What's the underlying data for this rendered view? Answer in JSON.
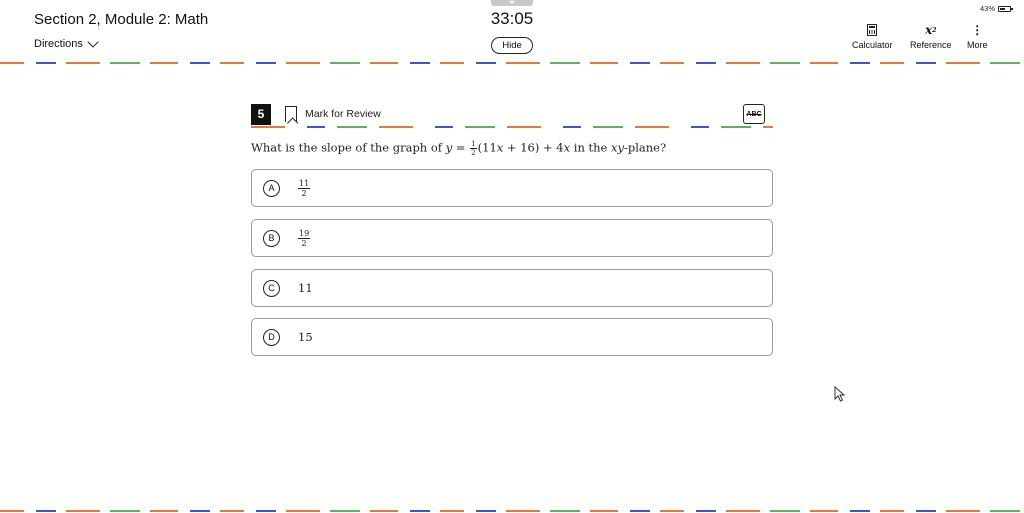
{
  "header": {
    "section_title": "Section 2, Module 2: Math",
    "directions_label": "Directions",
    "timer": "33:05",
    "hide_label": "Hide",
    "battery": "43%",
    "tools": [
      {
        "label": "Calculator",
        "icon": "calculator-icon"
      },
      {
        "label": "Reference",
        "icon": "reference-icon"
      },
      {
        "label": "More",
        "icon": "more-vertical-icon"
      }
    ]
  },
  "question": {
    "number": "5",
    "mark_for_review_label": "Mark for Review",
    "abc_label": "ABC",
    "text_before": "What is the slope of the graph of ",
    "eq_y": "y",
    "eq_equals": " = ",
    "eq_frac_num": "1",
    "eq_frac_den": "2",
    "eq_paren": "(11",
    "eq_x1": "x",
    "eq_mid": " + 16) + 4",
    "eq_x2": "x",
    "text_in_the": " in the ",
    "plane_var": "xy",
    "text_after": "-plane?"
  },
  "choices": [
    {
      "letter": "A",
      "numerator": "11",
      "denominator": "2"
    },
    {
      "letter": "B",
      "numerator": "19",
      "denominator": "2"
    },
    {
      "letter": "C",
      "value": "11"
    },
    {
      "letter": "D",
      "value": "15"
    }
  ],
  "colors": {
    "accent_orange": "#e07b39",
    "accent_blue": "#3a58c8",
    "accent_green": "#5ab55a"
  }
}
